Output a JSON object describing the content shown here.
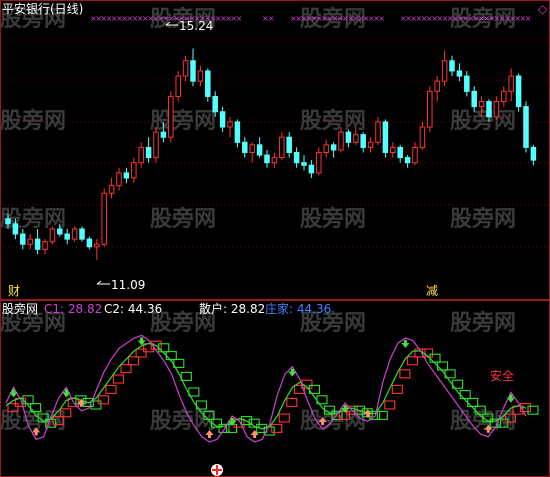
{
  "colors": {
    "background": "#000000",
    "up": "#ff3333",
    "down": "#54ffff",
    "panel_border": "#9a1a1a",
    "grid": "#7a0000",
    "purple_marker": "#d040d0",
    "c1_line": "#d040d0",
    "c2_line": "#30e030",
    "retail_box": "#30e030",
    "dealer_box": "#ff3333",
    "text_white": "#ffffff",
    "text_purple": "#d040d0",
    "text_blue": "#4080ff",
    "signal_yellow": "#ffe040",
    "arrow_up": "#ff9070",
    "arrow_down": "#40e040",
    "watermark": "#3a3a3a"
  },
  "title": "平安银行(日线)",
  "watermark": "股旁网",
  "top_marker": "◇",
  "price_annotations": {
    "high": "15.24",
    "low": "11.09"
  },
  "signals": {
    "cai": "财",
    "jian": "减"
  },
  "indicator_labels": {
    "name": "股旁网",
    "c1": "C1: 28.82",
    "c2": "C2: 44.36",
    "retail": "散户: 28.82",
    "dealer": "庄家: 44.36",
    "safe_zone": "安全"
  },
  "chart_data": [
    {
      "type": "candlestick",
      "title": "平安银行(日线)",
      "ylim": [
        10.6,
        15.8
      ],
      "grid": true,
      "candles": [
        {
          "o": 11.9,
          "h": 12.0,
          "l": 11.7,
          "c": 11.8
        },
        {
          "o": 11.8,
          "h": 11.9,
          "l": 11.5,
          "c": 11.6
        },
        {
          "o": 11.6,
          "h": 11.7,
          "l": 11.3,
          "c": 11.4
        },
        {
          "o": 11.4,
          "h": 11.6,
          "l": 11.3,
          "c": 11.5
        },
        {
          "o": 11.5,
          "h": 11.7,
          "l": 11.2,
          "c": 11.3
        },
        {
          "o": 11.3,
          "h": 11.5,
          "l": 11.2,
          "c": 11.45
        },
        {
          "o": 11.45,
          "h": 11.75,
          "l": 11.4,
          "c": 11.7
        },
        {
          "o": 11.7,
          "h": 11.8,
          "l": 11.55,
          "c": 11.6
        },
        {
          "o": 11.6,
          "h": 11.7,
          "l": 11.4,
          "c": 11.5
        },
        {
          "o": 11.5,
          "h": 11.75,
          "l": 11.45,
          "c": 11.7
        },
        {
          "o": 11.7,
          "h": 11.75,
          "l": 11.45,
          "c": 11.5
        },
        {
          "o": 11.5,
          "h": 11.55,
          "l": 11.3,
          "c": 11.35
        },
        {
          "o": 11.35,
          "h": 11.5,
          "l": 11.09,
          "c": 11.4
        },
        {
          "o": 11.4,
          "h": 12.5,
          "l": 11.35,
          "c": 12.4
        },
        {
          "o": 12.4,
          "h": 12.7,
          "l": 12.3,
          "c": 12.55
        },
        {
          "o": 12.55,
          "h": 12.9,
          "l": 12.45,
          "c": 12.8
        },
        {
          "o": 12.8,
          "h": 12.9,
          "l": 12.6,
          "c": 12.7
        },
        {
          "o": 12.7,
          "h": 13.1,
          "l": 12.6,
          "c": 13.0
        },
        {
          "o": 13.0,
          "h": 13.4,
          "l": 12.9,
          "c": 13.3
        },
        {
          "o": 13.3,
          "h": 13.5,
          "l": 13.0,
          "c": 13.1
        },
        {
          "o": 13.1,
          "h": 13.7,
          "l": 13.0,
          "c": 13.6
        },
        {
          "o": 13.6,
          "h": 13.8,
          "l": 13.4,
          "c": 13.5
        },
        {
          "o": 13.5,
          "h": 14.4,
          "l": 13.4,
          "c": 14.3
        },
        {
          "o": 14.3,
          "h": 14.8,
          "l": 14.2,
          "c": 14.7
        },
        {
          "o": 14.7,
          "h": 15.1,
          "l": 14.6,
          "c": 15.0
        },
        {
          "o": 15.0,
          "h": 15.24,
          "l": 14.5,
          "c": 14.6
        },
        {
          "o": 14.6,
          "h": 14.9,
          "l": 14.5,
          "c": 14.8
        },
        {
          "o": 14.8,
          "h": 14.85,
          "l": 14.2,
          "c": 14.3
        },
        {
          "o": 14.3,
          "h": 14.4,
          "l": 13.9,
          "c": 14.0
        },
        {
          "o": 14.0,
          "h": 14.1,
          "l": 13.6,
          "c": 13.7
        },
        {
          "o": 13.7,
          "h": 13.9,
          "l": 13.5,
          "c": 13.8
        },
        {
          "o": 13.8,
          "h": 13.85,
          "l": 13.3,
          "c": 13.4
        },
        {
          "o": 13.4,
          "h": 13.5,
          "l": 13.1,
          "c": 13.2
        },
        {
          "o": 13.2,
          "h": 13.4,
          "l": 13.0,
          "c": 13.35
        },
        {
          "o": 13.35,
          "h": 13.5,
          "l": 13.1,
          "c": 13.15
        },
        {
          "o": 13.15,
          "h": 13.25,
          "l": 12.9,
          "c": 13.0
        },
        {
          "o": 13.0,
          "h": 13.2,
          "l": 12.9,
          "c": 13.1
        },
        {
          "o": 13.1,
          "h": 13.6,
          "l": 13.05,
          "c": 13.5
        },
        {
          "o": 13.5,
          "h": 13.6,
          "l": 13.1,
          "c": 13.2
        },
        {
          "o": 13.2,
          "h": 13.3,
          "l": 12.9,
          "c": 13.0
        },
        {
          "o": 13.0,
          "h": 13.15,
          "l": 12.85,
          "c": 12.95
        },
        {
          "o": 12.95,
          "h": 13.05,
          "l": 12.7,
          "c": 12.8
        },
        {
          "o": 12.8,
          "h": 13.3,
          "l": 12.75,
          "c": 13.2
        },
        {
          "o": 13.2,
          "h": 13.45,
          "l": 13.1,
          "c": 13.35
        },
        {
          "o": 13.35,
          "h": 13.4,
          "l": 13.1,
          "c": 13.25
        },
        {
          "o": 13.25,
          "h": 13.7,
          "l": 13.2,
          "c": 13.6
        },
        {
          "o": 13.6,
          "h": 13.65,
          "l": 13.3,
          "c": 13.4
        },
        {
          "o": 13.4,
          "h": 13.7,
          "l": 13.35,
          "c": 13.55
        },
        {
          "o": 13.55,
          "h": 13.6,
          "l": 13.2,
          "c": 13.3
        },
        {
          "o": 13.3,
          "h": 13.5,
          "l": 13.2,
          "c": 13.4
        },
        {
          "o": 13.4,
          "h": 13.9,
          "l": 13.35,
          "c": 13.8
        },
        {
          "o": 13.8,
          "h": 13.85,
          "l": 13.1,
          "c": 13.2
        },
        {
          "o": 13.2,
          "h": 13.4,
          "l": 13.1,
          "c": 13.3
        },
        {
          "o": 13.3,
          "h": 13.35,
          "l": 13.0,
          "c": 13.1
        },
        {
          "o": 13.1,
          "h": 13.15,
          "l": 12.9,
          "c": 13.0
        },
        {
          "o": 13.0,
          "h": 13.4,
          "l": 12.95,
          "c": 13.3
        },
        {
          "o": 13.3,
          "h": 13.8,
          "l": 13.25,
          "c": 13.7
        },
        {
          "o": 13.7,
          "h": 14.5,
          "l": 13.6,
          "c": 14.4
        },
        {
          "o": 14.4,
          "h": 14.7,
          "l": 14.2,
          "c": 14.6
        },
        {
          "o": 14.6,
          "h": 15.2,
          "l": 14.5,
          "c": 15.0
        },
        {
          "o": 15.0,
          "h": 15.1,
          "l": 14.7,
          "c": 14.8
        },
        {
          "o": 14.8,
          "h": 14.95,
          "l": 14.6,
          "c": 14.7
        },
        {
          "o": 14.7,
          "h": 14.8,
          "l": 14.3,
          "c": 14.4
        },
        {
          "o": 14.4,
          "h": 14.5,
          "l": 14.0,
          "c": 14.1
        },
        {
          "o": 14.1,
          "h": 14.3,
          "l": 13.9,
          "c": 14.2
        },
        {
          "o": 14.2,
          "h": 14.25,
          "l": 13.8,
          "c": 13.9
        },
        {
          "o": 13.9,
          "h": 14.3,
          "l": 13.85,
          "c": 14.2
        },
        {
          "o": 14.2,
          "h": 14.5,
          "l": 14.1,
          "c": 14.4
        },
        {
          "o": 14.4,
          "h": 14.85,
          "l": 14.2,
          "c": 14.7
        },
        {
          "o": 14.7,
          "h": 14.75,
          "l": 14.0,
          "c": 14.1
        },
        {
          "o": 14.1,
          "h": 14.2,
          "l": 13.2,
          "c": 13.3
        },
        {
          "o": 13.3,
          "h": 13.35,
          "l": 12.95,
          "c": 13.05
        }
      ]
    },
    {
      "type": "line",
      "title": "",
      "series": [
        {
          "name": "C1",
          "values": [
            40,
            52,
            42,
            22,
            12,
            14,
            30,
            44,
            52,
            40,
            34,
            36,
            50,
            64,
            74,
            82,
            86,
            90,
            92,
            88,
            80,
            72,
            62,
            46,
            32,
            22,
            14,
            10,
            12,
            20,
            30,
            26,
            14,
            10,
            12,
            24,
            46,
            62,
            68,
            58,
            42,
            28,
            20,
            24,
            32,
            40,
            34,
            28,
            26,
            30,
            56,
            74,
            86,
            90,
            88,
            80,
            70,
            62,
            54,
            46,
            38,
            30,
            22,
            16,
            14,
            22,
            36,
            48,
            40,
            30
          ]
        },
        {
          "name": "C2",
          "values": [
            38,
            42,
            44,
            38,
            30,
            26,
            28,
            34,
            42,
            44,
            42,
            40,
            44,
            52,
            60,
            68,
            74,
            80,
            84,
            86,
            84,
            78,
            72,
            62,
            50,
            40,
            32,
            26,
            22,
            22,
            26,
            28,
            26,
            22,
            20,
            22,
            30,
            42,
            52,
            56,
            52,
            44,
            36,
            32,
            32,
            36,
            36,
            34,
            32,
            32,
            40,
            52,
            64,
            74,
            80,
            80,
            76,
            70,
            64,
            56,
            48,
            42,
            36,
            30,
            26,
            26,
            30,
            36,
            38,
            36
          ]
        }
      ]
    }
  ]
}
